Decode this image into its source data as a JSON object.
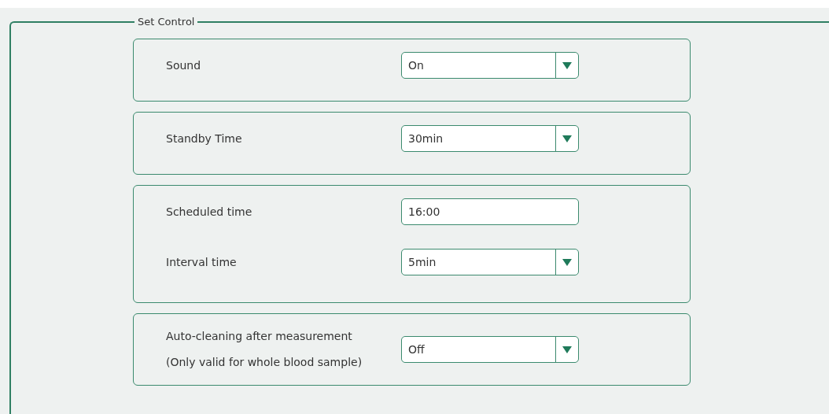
{
  "group": {
    "title": "Set Control"
  },
  "cards": [
    {
      "rows": [
        {
          "kind": "dropdown",
          "label": "Sound",
          "value": "On"
        }
      ]
    },
    {
      "rows": [
        {
          "kind": "dropdown",
          "label": "Standby Time",
          "value": "30min"
        }
      ]
    },
    {
      "rows": [
        {
          "kind": "text",
          "label": "Scheduled time",
          "value": "16:00"
        },
        {
          "kind": "dropdown",
          "label": "Interval time",
          "value": "5min"
        }
      ]
    },
    {
      "rows": [
        {
          "kind": "dropdown",
          "label": "Auto-cleaning after measurement",
          "note": "(Only valid for whole blood sample)",
          "value": "Off"
        }
      ]
    }
  ]
}
